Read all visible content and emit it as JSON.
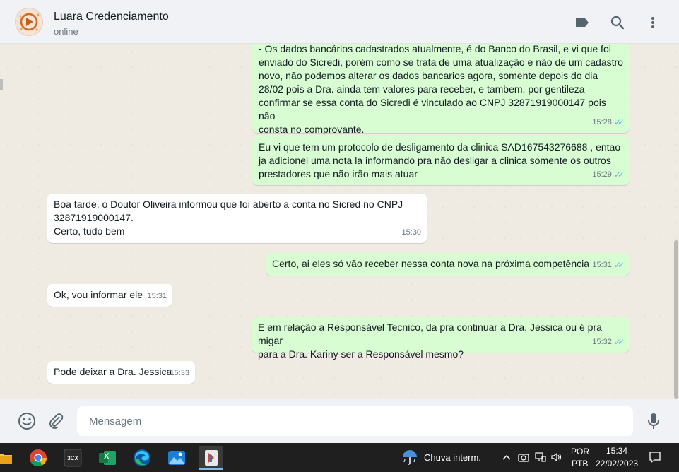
{
  "header": {
    "contact_name": "Luara Credenciamento",
    "status": "online",
    "icons": [
      "label-icon",
      "search-icon",
      "menu-icon"
    ]
  },
  "messages": [
    {
      "dir": "out",
      "text": "- Os dados bancários cadastrados atualmente, é do Banco do Brasil, e vi que foi\nenviado do Sicredi, porém como se trata de uma atualização e não de um cadastro\nnovo, não podemos alterar os dados bancarios agora, somente depois do dia\n28/02 pois a Dra. ainda tem valores para receber, e tambem, por gentileza\nconfirmar se essa conta do Sicredi é vinculado ao CNPJ 32871919000147 pois não\nconsta no comprovante.",
      "time": "15:28",
      "read": true
    },
    {
      "dir": "out",
      "text": "Eu vi que tem um protocolo de desligamento da clinica SAD167543276688 , entao\nja adicionei uma nota la informando pra não desligar a clinica somente os outros\nprestadores que não irão mais atuar",
      "time": "15:29",
      "read": true
    },
    {
      "dir": "in",
      "text": "Boa tarde, o Doutor Oliveira informou que foi aberto a conta no Sicred no CNPJ\n32871919000147.\nCerto, tudo bem",
      "time": "15:30"
    },
    {
      "dir": "out",
      "text": "Certo, ai eles só vão receber nessa conta nova na próxima competência",
      "time": "15:31",
      "read": true
    },
    {
      "dir": "in",
      "text": "Ok, vou informar ele",
      "time": "15:31"
    },
    {
      "dir": "out",
      "text": "E em relação a Responsável Tecnico, da pra continuar a Dra. Jessica ou é pra migar\npara a Dra. Kariny ser a Responsável mesmo?",
      "time": "15:32",
      "read": true
    },
    {
      "dir": "in",
      "text": "Pode deixar a Dra. Jessica",
      "time": "15:33"
    }
  ],
  "composer": {
    "placeholder": "Mensagem",
    "icons": [
      "emoji-icon",
      "attach-icon",
      "microphone-icon"
    ]
  },
  "taskbar": {
    "apps": [
      "file-explorer-icon",
      "chrome-icon",
      "3cx-icon",
      "excel-icon",
      "edge-icon",
      "photos-icon",
      "active-app-icon"
    ],
    "app_label_3cx": "3CX",
    "app_label_excel": "X",
    "weather_text": "Chuva interm.",
    "lang_line1": "POR",
    "lang_line2": "PTB",
    "time": "15:34",
    "date": "22/02/2023"
  },
  "colors": {
    "outgoing_bubble": "#d9fdd3",
    "incoming_bubble": "#ffffff",
    "chat_background": "#efeae2",
    "read_ticks": "#53bdeb"
  }
}
